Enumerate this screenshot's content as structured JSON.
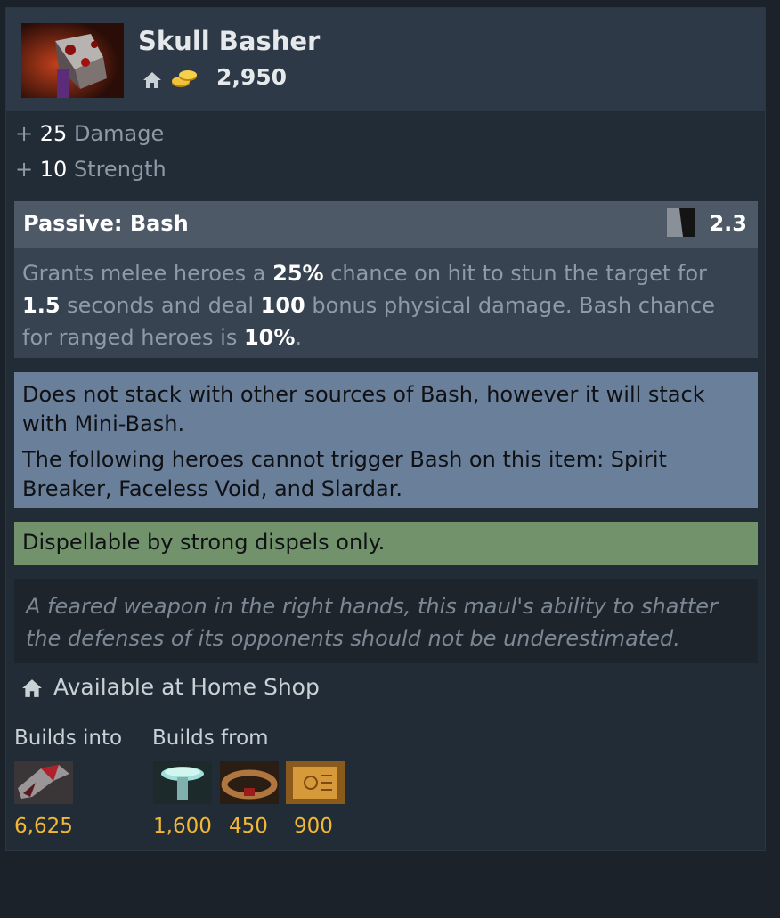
{
  "item": {
    "name": "Skull Basher",
    "icon": "skull-basher-icon",
    "shop_icon": "home-icon",
    "currency_icon": "gold-coins-icon",
    "cost": "2,950"
  },
  "stats": [
    {
      "sign": "+",
      "value": "25",
      "label": "Damage"
    },
    {
      "sign": "+",
      "value": "10",
      "label": "Strength"
    }
  ],
  "ability": {
    "name": "Passive: Bash",
    "cooldown_icon": "cooldown-icon",
    "cooldown": "2.3",
    "description": {
      "t1": "Grants melee heroes a ",
      "chance_melee": "25%",
      "t2": " chance on hit to stun the target for ",
      "duration": "1.5",
      "t3": " seconds and deal ",
      "damage": "100",
      "t4": " bonus physical damage. Bash chance for ranged heroes is ",
      "chance_ranged": "10%",
      "t5": "."
    }
  },
  "notes": [
    "Does not stack with other sources of Bash, however it will stack with Mini-Bash.",
    "The following heroes cannot trigger Bash on this item: Spirit Breaker, Faceless Void, and Slardar."
  ],
  "dispel": "Dispellable by strong dispels only.",
  "lore": "A feared weapon in the right hands, this maul's ability to shatter the defenses of its opponents should not be underestimated.",
  "availability": "Available at Home Shop",
  "builds_into": {
    "label": "Builds into",
    "items": [
      {
        "icon": "abyssal-blade-icon",
        "cost": "6,625"
      }
    ]
  },
  "builds_from": {
    "label": "Builds from",
    "items": [
      {
        "icon": "mithril-hammer-icon",
        "cost": "1,600"
      },
      {
        "icon": "belt-of-strength-icon",
        "cost": "450"
      },
      {
        "icon": "recipe-scroll-icon",
        "cost": "900"
      }
    ]
  },
  "colors": {
    "background": "#1c2229",
    "card": "#222c37",
    "header": "#2d3946",
    "ability_header": "#4d5966",
    "ability_body": "#374350",
    "note": "#6a7f9a",
    "dispel": "#71926a",
    "lore": "#1d242c",
    "gold": "#f2b835"
  }
}
